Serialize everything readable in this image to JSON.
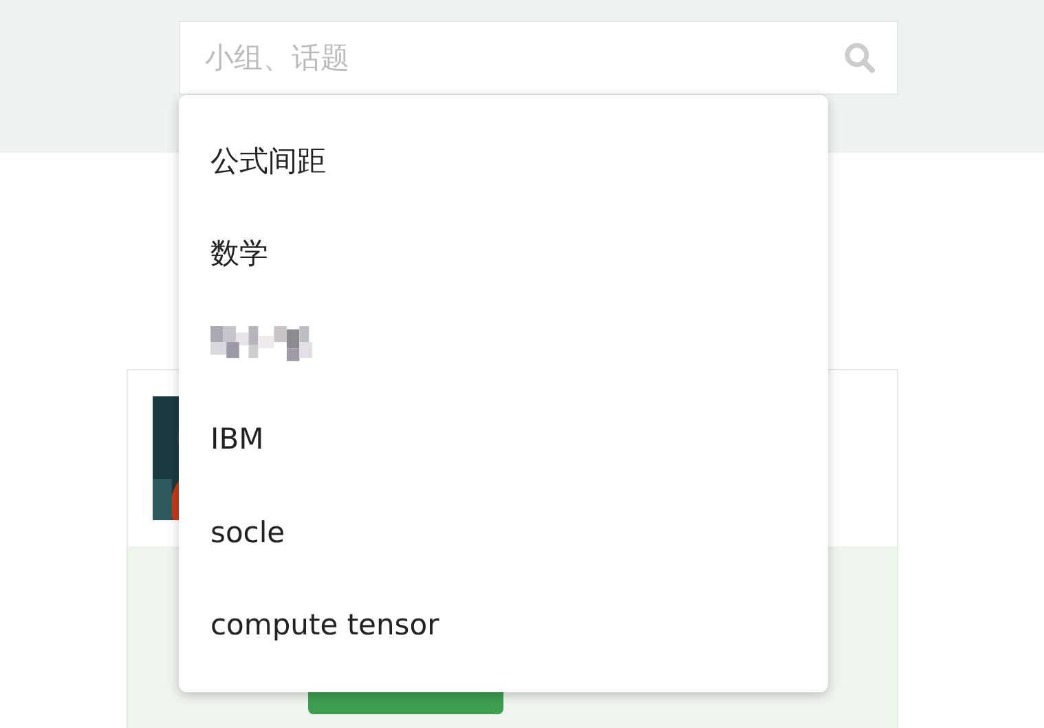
{
  "search": {
    "placeholder": "小组、话题"
  },
  "suggestions": [
    {
      "kind": "text",
      "label": "公式间距"
    },
    {
      "kind": "text",
      "label": "数学"
    },
    {
      "kind": "redacted"
    },
    {
      "kind": "text",
      "label": "IBM"
    },
    {
      "kind": "text",
      "label": "socle"
    },
    {
      "kind": "text",
      "label": "compute tensor"
    }
  ]
}
